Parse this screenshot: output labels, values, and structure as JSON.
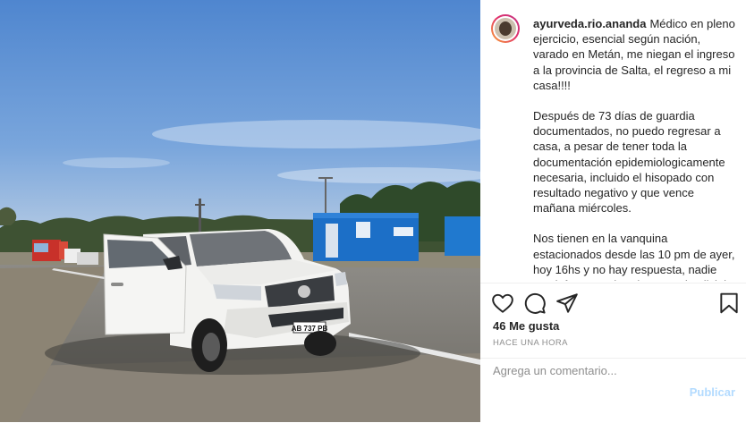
{
  "post": {
    "username": "ayurveda.rio.ananda",
    "caption_paragraphs": [
      "Médico en pleno ejercicio, esencial según nación, varado en Metán, me niegan el ingreso a la provincia de Salta, el regreso a mi casa!!!!",
      "Después de 73 días de guardia documentados, no puedo regresar a casa, a pesar de tener toda la documentación epidemiologicamente necesaria, incluido el hisopado con resultado negativo y que vence mañana miércoles.",
      "Nos tienen en la vanquina estacionados desde las 10 pm de ayer, hoy 16hs y no hay respuesta, nadie nos informa nada. El personal policial no sabe qué hacer, solo cumple órdenes."
    ],
    "likes": "46 Me gusta",
    "timestamp": "HACE UNA HORA",
    "comment_placeholder": "Agrega un comentario...",
    "publish_label": "Publicar"
  },
  "photo": {
    "license_plate": "AB 737 PB"
  },
  "icons": {
    "like": "heart-icon",
    "comment": "comment-icon",
    "share": "share-icon",
    "save": "bookmark-icon"
  },
  "colors": {
    "publish_disabled": "#b3dbff",
    "text": "#262626",
    "muted": "#8e8e8e"
  }
}
